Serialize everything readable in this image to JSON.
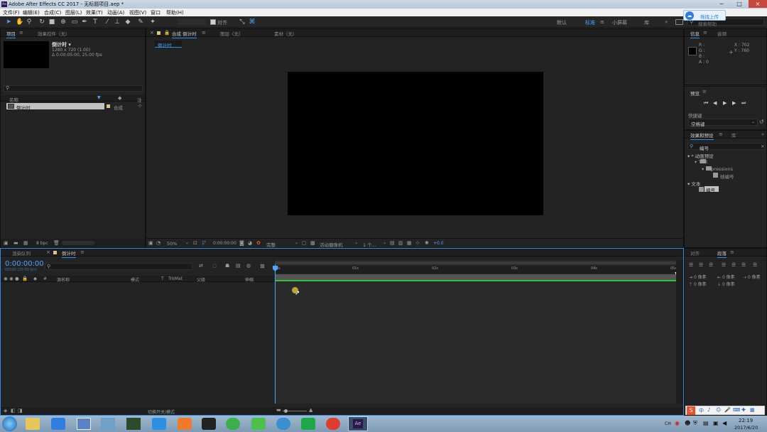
{
  "app": {
    "title": "Adobe After Effects CC 2017 - 无标题项目.aep *",
    "logo": "Ae",
    "colors": {
      "accent": "#2d8ceb",
      "timecode": "#4da3ff",
      "workarea_green": "#35c135"
    }
  },
  "window_buttons": [
    "−",
    "□",
    "×"
  ],
  "menus": [
    "文件(F)",
    "编辑(E)",
    "合成(C)",
    "图层(L)",
    "效果(T)",
    "动画(A)",
    "视图(V)",
    "窗口",
    "帮助(H)"
  ],
  "toolbar": {
    "align_label": "对齐",
    "workspaces": [
      "默认",
      "标准",
      "小屏幕",
      "库"
    ],
    "active_workspace": "标准",
    "search_placeholder": "搜索帮助"
  },
  "baidu_popup": {
    "label": "拖拽上传"
  },
  "project_panel": {
    "tabs": [
      "项目",
      "效果控件（无）"
    ],
    "comp_name": "倒计时 ▾",
    "comp_info1": "1280 x 720 (1.00)",
    "comp_info2": "Δ 0:00:05:00, 25.00 fps",
    "col_name": "名称",
    "col_comment": "注",
    "item_name": "倒计时",
    "item_type": "合成",
    "bpc": "8 bpc"
  },
  "viewer": {
    "tabs": [
      "合成 倒计时",
      "图层（无）",
      "素材（无）"
    ],
    "breadcrumb": "倒计时",
    "zoom": "50%",
    "timecode": "0:00:00:00",
    "quality": "完整",
    "camera": "活动摄像机",
    "views": "1 个...",
    "exposure": "+0.0"
  },
  "info_panel": {
    "tabs": [
      "信息",
      "音频"
    ],
    "r": "R :",
    "g": "G :",
    "b": "B :",
    "a": "A : 0",
    "x": "X : 702",
    "y": "Y : 760"
  },
  "preview_panel": {
    "title": "预览",
    "shortcut_label": "快捷键",
    "shortcut_value": "空格键"
  },
  "effects_panel": {
    "tabs": [
      "效果和预设",
      "库"
    ],
    "search_value": "编号",
    "tree": [
      "▾ * 动画预设",
      "▾ Text",
      "▾ Expressions",
      "帧编号",
      "▾ 文本",
      "编号"
    ]
  },
  "align_panel": {
    "tabs": [
      "对齐",
      "段落"
    ],
    "fields": [
      "0 像素",
      "0 像素",
      "0 像素",
      "0 像素",
      "0 像素"
    ]
  },
  "timeline": {
    "tabs": [
      "渲染队列",
      "倒计时"
    ],
    "timecode": "0:00:00:00",
    "frames": "00000 (25.00 fps)",
    "columns": [
      "#",
      "源名称",
      "模式",
      "T",
      "TrkMat",
      "父级",
      "伸缩"
    ],
    "ruler": [
      "0s",
      "01s",
      "02s",
      "03s",
      "04s",
      "05s"
    ],
    "footer": "切换开关/模式"
  },
  "taskbar": {
    "clock_time": "22:19",
    "clock_date": "2017/6/20",
    "lang": "CH",
    "apps": [
      "win",
      "folder",
      "baidu",
      "window",
      "box",
      "cube",
      "word",
      "ppt",
      "penguin",
      "360",
      "wechat",
      "disc",
      "wps",
      "netease",
      "Ae"
    ]
  }
}
